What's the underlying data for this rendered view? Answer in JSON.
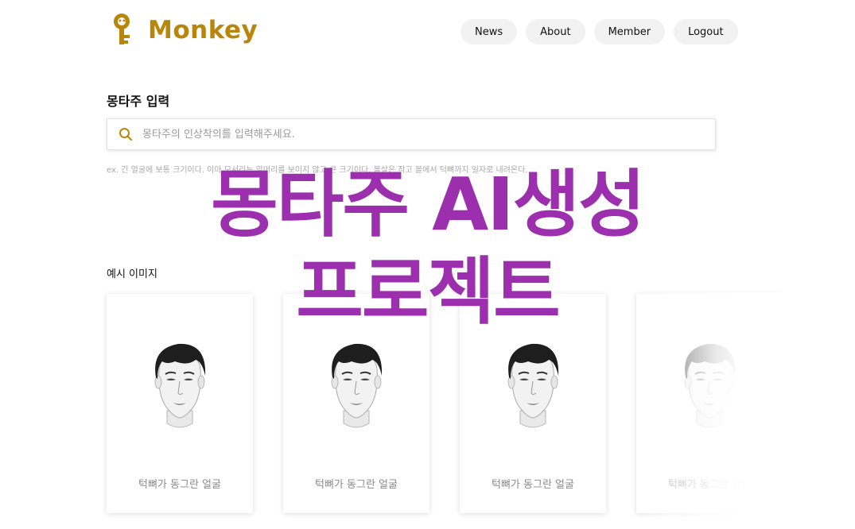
{
  "brand": {
    "name": "Monkey",
    "accent_color": "#b8860b",
    "icon": "monkey-key-icon"
  },
  "nav": {
    "items": [
      {
        "label": "News"
      },
      {
        "label": "About"
      },
      {
        "label": "Member"
      },
      {
        "label": "Logout"
      }
    ]
  },
  "input_section": {
    "title": "몽타주 입력",
    "search": {
      "icon": "search-icon",
      "placeholder": "몽타주의 인상착의를 입력해주세요.",
      "value": ""
    },
    "example": "ex. 긴 얼굴에 보통 크기이다. 이마 모서리는 앞머리를 보이지 않고 큰 크기이다. 볼살은 작고 볼에서 턱뼈까지 일자로 내려온다."
  },
  "examples": {
    "title": "예시 이미지",
    "cards": [
      {
        "caption": "턱뼈가 동그란 얼굴"
      },
      {
        "caption": "턱뼈가 동그란 얼굴"
      },
      {
        "caption": "턱뼈가 동그란 얼굴"
      },
      {
        "caption": "턱뼈가 동그란 얼굴"
      }
    ]
  },
  "banner": {
    "line1": "몽타주 AI생성",
    "line2": "프로젝트",
    "color": "#9b2fae"
  }
}
